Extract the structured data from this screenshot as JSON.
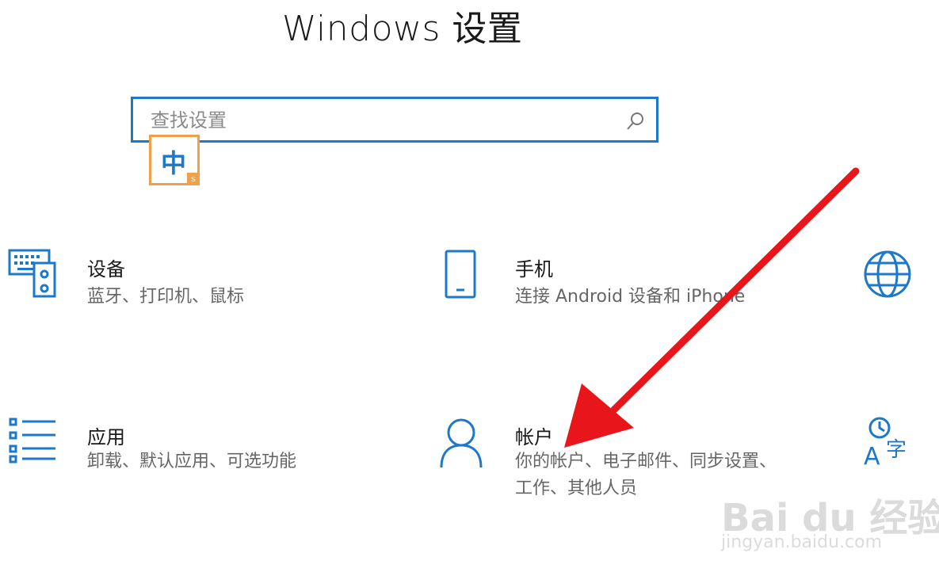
{
  "window": {
    "title": "Windows 设置"
  },
  "search": {
    "placeholder": "查找设置"
  },
  "ime": {
    "char": "中",
    "badge": "s"
  },
  "tiles": [
    {
      "name": "设备",
      "desc": "蓝牙、打印机、鼠标",
      "icon": "devices-icon"
    },
    {
      "name": "手机",
      "desc": "连接 Android 设备和 iPhone",
      "icon": "phone-icon"
    },
    {
      "name": "应用",
      "desc": "卸载、默认应用、可选功能",
      "icon": "apps-icon"
    },
    {
      "name": "帐户",
      "desc": "你的帐户、电子邮件、同步设置、工作、其他人员",
      "icon": "account-icon"
    }
  ],
  "colors": {
    "accent": "#1e78c8",
    "ime_border": "#f0a04b",
    "annotation_arrow": "#e8161b"
  },
  "watermark": {
    "brand": "Bai du 经验",
    "url": "jingyan.baidu.com"
  }
}
